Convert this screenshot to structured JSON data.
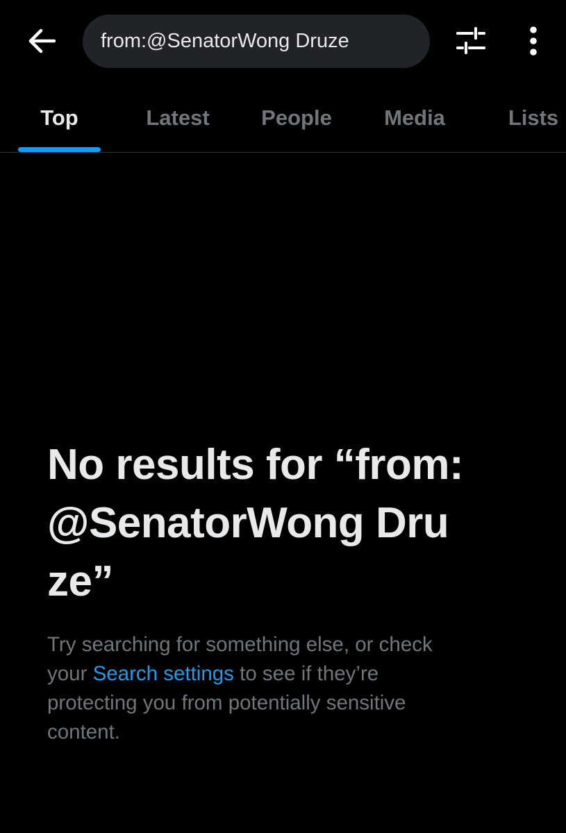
{
  "header": {
    "back_icon": "arrow-left-icon",
    "search_value": "from:@SenatorWong Druze",
    "filter_icon": "sliders-icon",
    "more_icon": "more-vertical-icon"
  },
  "tabs": [
    {
      "label": "Top",
      "active": true
    },
    {
      "label": "Latest",
      "active": false
    },
    {
      "label": "People",
      "active": false
    },
    {
      "label": "Media",
      "active": false
    },
    {
      "label": "Lists",
      "active": false
    }
  ],
  "empty_state": {
    "title": "No results for “from:@SenatorWong Druze”",
    "desc_before": "Try searching for something else, or check your ",
    "desc_link": "Search settings",
    "desc_after": " to see if they’re protecting you from potentially sensitive content."
  },
  "colors": {
    "background": "#000000",
    "accent": "#1d9bf0",
    "text_primary": "#e7e9ea",
    "text_secondary": "#71767b",
    "search_bg": "#202327",
    "divider": "#2f3336"
  }
}
